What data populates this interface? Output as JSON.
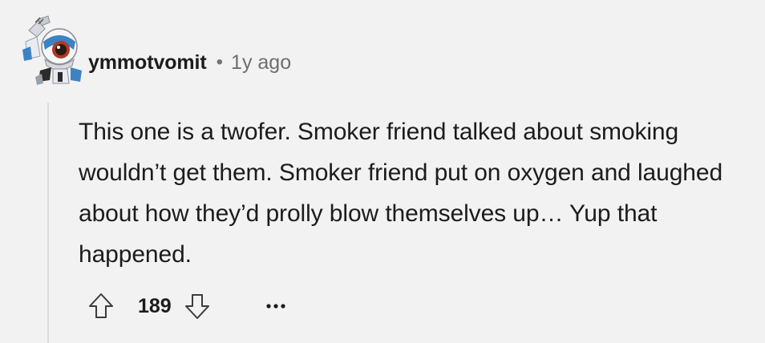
{
  "comment": {
    "username": "ymmotvomit",
    "separator": "•",
    "timestamp": "1y ago",
    "body": "This one is a twofer. Smoker friend talked about smoking wouldn’t get them. Smoker friend put on oxygen and laughed about how they’d prolly blow themselves up… Yup that happened.",
    "score": "189",
    "avatar_icon": "robot-avatar-icon"
  },
  "actions": {
    "upvote_icon": "arrow-up-icon",
    "downvote_icon": "arrow-down-icon",
    "more_icon": "ellipsis-icon"
  },
  "colors": {
    "background": "#f2f2f2",
    "text": "#1c1c1c",
    "muted": "#6e6e6e",
    "thread_line": "#dcdcdc"
  }
}
